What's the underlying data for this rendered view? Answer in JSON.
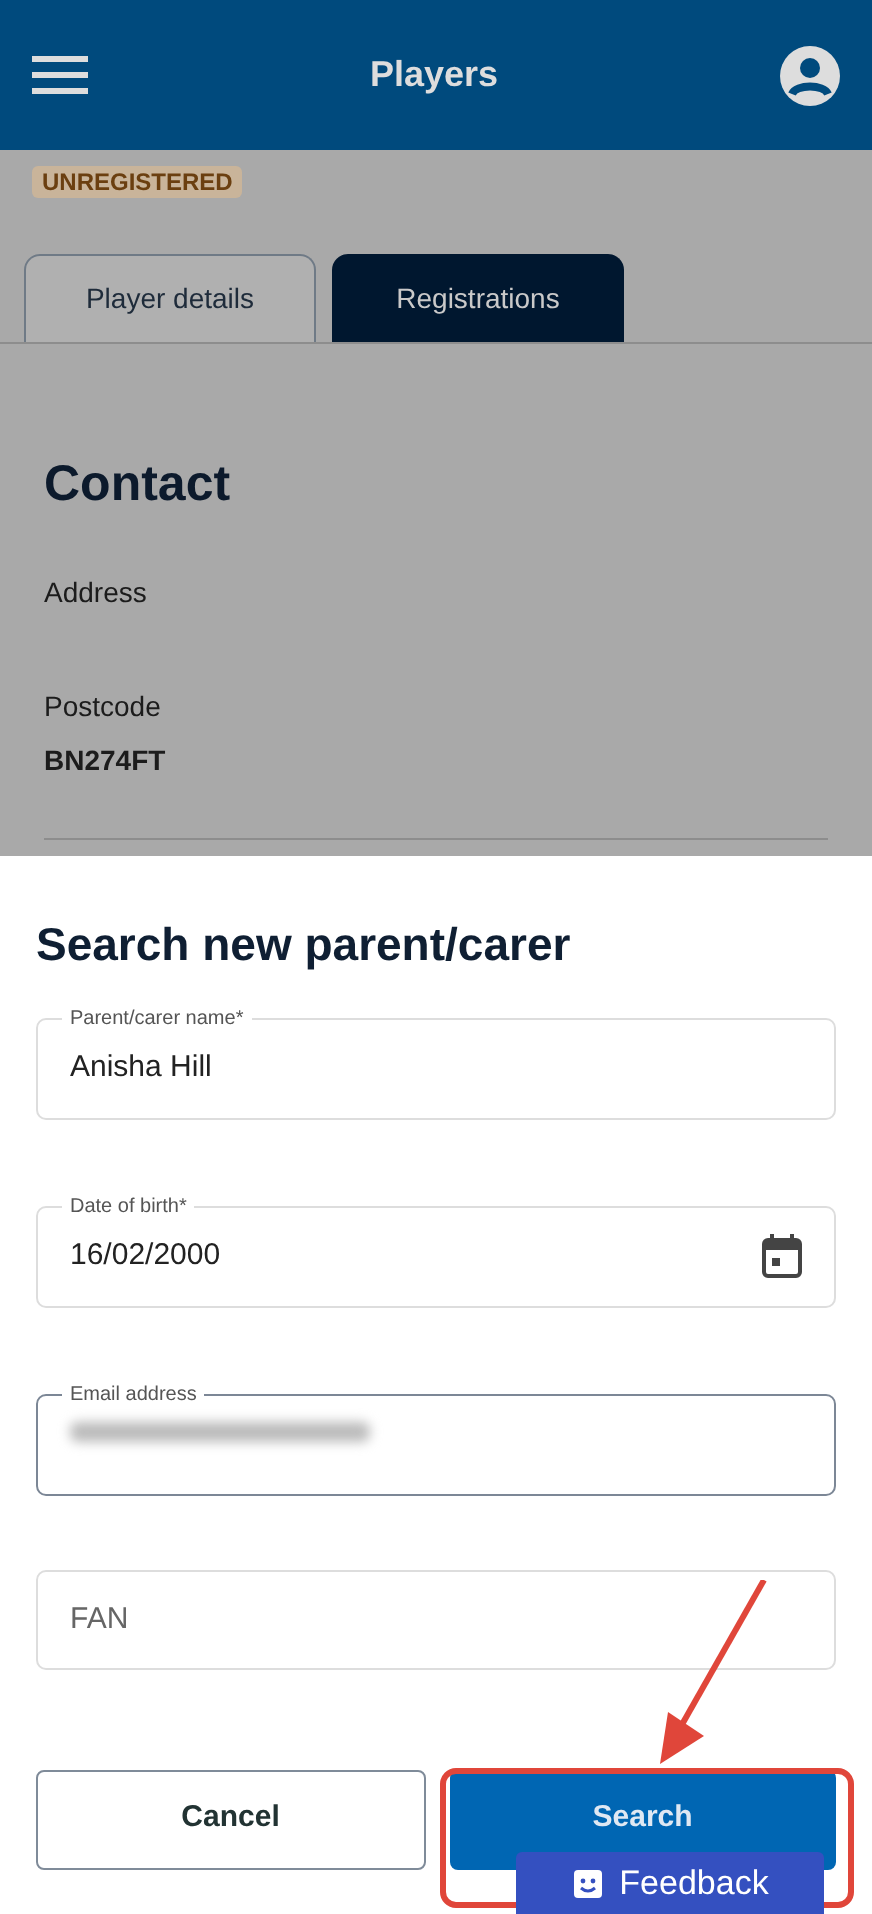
{
  "header": {
    "title": "Players"
  },
  "status_badge": "UNREGISTERED",
  "tabs": [
    {
      "label": "Player details",
      "selected": false
    },
    {
      "label": "Registrations",
      "selected": true
    }
  ],
  "contact": {
    "heading": "Contact",
    "fields": [
      {
        "label": "Address"
      },
      {
        "label": "Postcode",
        "value": "BN274FT"
      }
    ]
  },
  "sheet": {
    "title": "Search new parent/carer",
    "fields": [
      {
        "kind": "text",
        "label": "Parent/carer name*",
        "value": "Anisha Hill"
      },
      {
        "kind": "date",
        "label": "Date of birth*",
        "value": "16/02/2000"
      },
      {
        "kind": "redacted",
        "label": "Email address",
        "focused": true
      },
      {
        "kind": "text",
        "placeholder": "FAN"
      }
    ],
    "buttons": [
      {
        "label": "Cancel",
        "kind": "outline"
      },
      {
        "label": "Search",
        "kind": "primary"
      }
    ]
  },
  "feedback_tab": {
    "label": "Feedback"
  }
}
